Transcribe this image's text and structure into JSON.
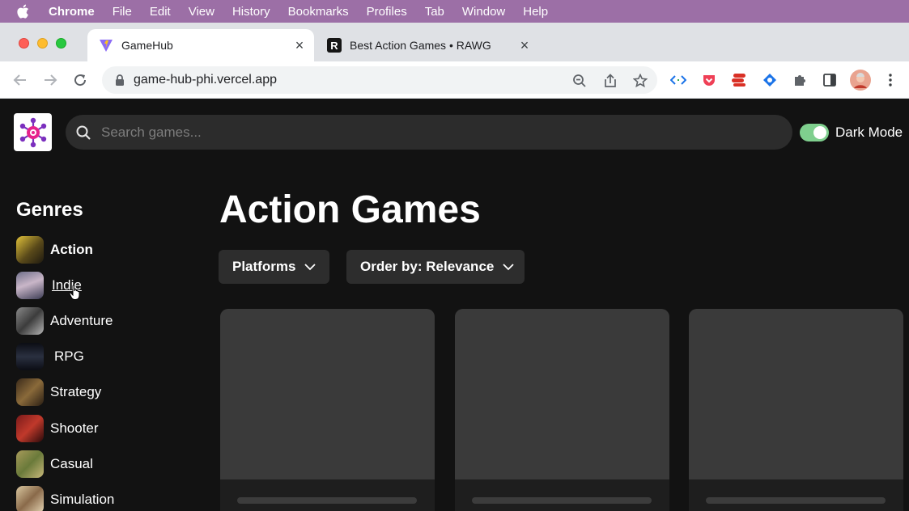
{
  "menubar": {
    "app_name": "Chrome",
    "items": [
      "File",
      "Edit",
      "View",
      "History",
      "Bookmarks",
      "Profiles",
      "Tab",
      "Window",
      "Help"
    ]
  },
  "tabs": [
    {
      "title": "GameHub",
      "favicon": "vite-logo-icon",
      "active": true
    },
    {
      "title": "Best Action Games • RAWG",
      "favicon": "rawg-logo-icon",
      "active": false
    }
  ],
  "toolbar": {
    "url": "game-hub-phi.vercel.app"
  },
  "header": {
    "search_placeholder": "Search games...",
    "dark_mode_label": "Dark Mode",
    "dark_mode_on": true,
    "toggle_color": "#7fcf8e"
  },
  "sidebar": {
    "heading": "Genres",
    "items": [
      {
        "label": "Action",
        "selected": true
      },
      {
        "label": "Indie",
        "hover": true
      },
      {
        "label": "Adventure"
      },
      {
        "label": "RPG"
      },
      {
        "label": "Strategy"
      },
      {
        "label": "Shooter"
      },
      {
        "label": "Casual"
      },
      {
        "label": "Simulation"
      }
    ]
  },
  "main": {
    "title": "Action Games",
    "platforms_label": "Platforms",
    "order_label": "Order by: Relevance",
    "skeleton_cards": 3
  },
  "colors": {
    "page_bg": "#121212",
    "menubar_bg": "#9c6fa6",
    "skeleton": "#3a3a3a"
  }
}
